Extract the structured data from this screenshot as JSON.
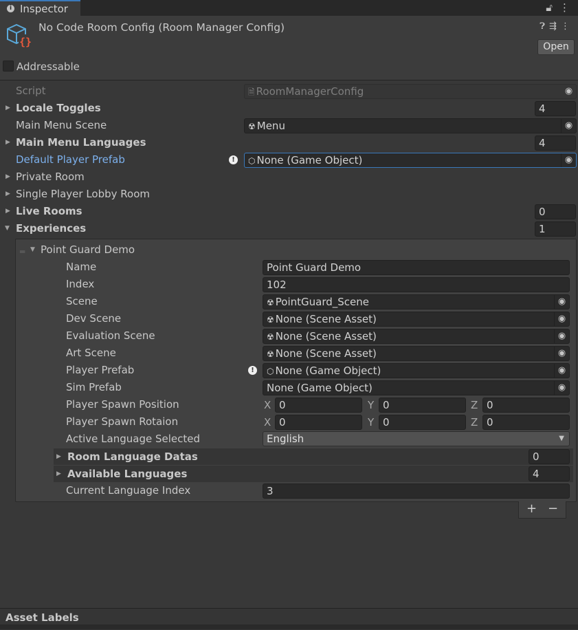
{
  "tab": {
    "label": "Inspector"
  },
  "header": {
    "title": "No Code Room Config (Room Manager Config)",
    "open_label": "Open",
    "addressable_label": "Addressable",
    "icons": [
      "help-icon",
      "preset-icon",
      "more-icon"
    ]
  },
  "fields": {
    "script_label": "Script",
    "script_value": "RoomManagerConfig",
    "locale_toggles_label": "Locale Toggles",
    "locale_toggles_count": "4",
    "main_menu_scene_label": "Main Menu Scene",
    "main_menu_scene_value": "Menu",
    "main_menu_languages_label": "Main Menu Languages",
    "main_menu_languages_count": "4",
    "default_player_prefab_label": "Default Player Prefab",
    "default_player_prefab_value": "None (Game Object)",
    "private_room_label": "Private Room",
    "single_player_lobby_label": "Single Player Lobby Room",
    "live_rooms_label": "Live Rooms",
    "live_rooms_count": "0",
    "experiences_label": "Experiences",
    "experiences_count": "1"
  },
  "element": {
    "header": "Point Guard Demo",
    "name_label": "Name",
    "name_value": "Point Guard Demo",
    "index_label": "Index",
    "index_value": "102",
    "scene_label": "Scene",
    "scene_value": "PointGuard_Scene",
    "dev_scene_label": "Dev Scene",
    "dev_scene_value": "None (Scene Asset)",
    "eval_scene_label": "Evaluation Scene",
    "eval_scene_value": "None (Scene Asset)",
    "art_scene_label": "Art Scene",
    "art_scene_value": "None (Scene Asset)",
    "player_prefab_label": "Player Prefab",
    "player_prefab_value": "None (Game Object)",
    "sim_prefab_label": "Sim Prefab",
    "sim_prefab_value": "None (Game Object)",
    "spawn_pos_label": "Player Spawn Position",
    "spawn_pos": {
      "x": "0",
      "y": "0",
      "z": "0"
    },
    "spawn_rot_label": "Player Spawn Rotaion",
    "spawn_rot": {
      "x": "0",
      "y": "0",
      "z": "0"
    },
    "axis": {
      "x": "X",
      "y": "Y",
      "z": "Z"
    },
    "active_lang_label": "Active Language Selected",
    "active_lang_value": "English",
    "room_lang_datas_label": "Room Language Datas",
    "room_lang_datas_count": "0",
    "available_langs_label": "Available Languages",
    "available_langs_count": "4",
    "current_lang_index_label": "Current Language Index",
    "current_lang_index_value": "3"
  },
  "list_controls": {
    "add": "+",
    "remove": "−"
  },
  "footer": {
    "label": "Asset Labels"
  },
  "colors": {
    "accent": "#3a79bb",
    "link": "#7cb0ec",
    "background": "#383838"
  }
}
